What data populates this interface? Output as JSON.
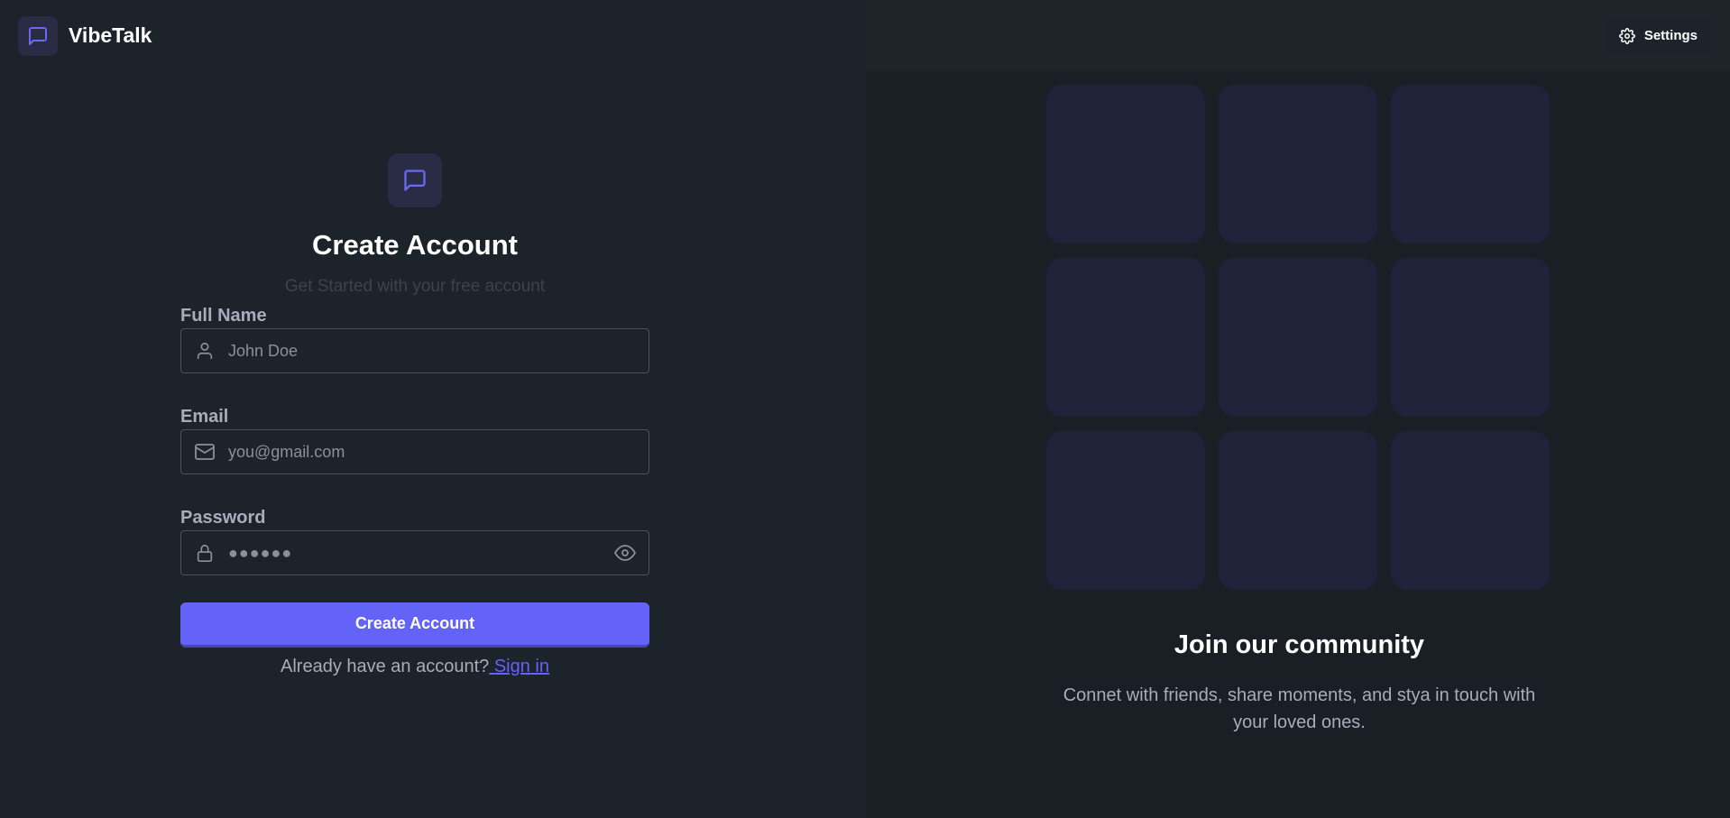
{
  "app": {
    "name": "VibeTalk"
  },
  "header": {
    "settings_label": "Settings"
  },
  "form": {
    "title": "Create Account",
    "subtitle": "Get Started with your free account",
    "full_name": {
      "label": "Full Name",
      "placeholder": "John Doe"
    },
    "email": {
      "label": "Email",
      "placeholder": "you@gmail.com"
    },
    "password": {
      "label": "Password",
      "value_masked": "●●●●●●"
    },
    "submit_label": "Create Account",
    "signin_prompt": "Already have an account?",
    "signin_link": " Sign in"
  },
  "community": {
    "title": "Join our community",
    "text": "Connet with friends, share moments, and stya in touch with your loved ones."
  },
  "colors": {
    "primary": "#6463f8",
    "background": "#1d232a",
    "tile": "#20223a"
  },
  "icons": {
    "brand": "chat-bubble-icon",
    "settings": "gear-icon",
    "name": "user-icon",
    "email": "mail-icon",
    "password": "lock-icon",
    "toggle": "eye-icon"
  }
}
